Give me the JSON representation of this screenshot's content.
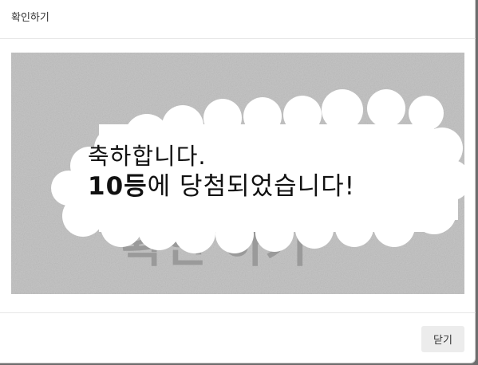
{
  "modal": {
    "title": "확인하기",
    "close_label": "닫기"
  },
  "scratch_card": {
    "cover_text": "확인 하기",
    "result_line1": "축하합니다.",
    "result_prize": "10등",
    "result_rest": "에 당첨되었습니다!"
  },
  "colors": {
    "overlay": "#6e6e6e",
    "scratch_cover": "#c4c4c4",
    "close_button_bg": "#ececec"
  }
}
